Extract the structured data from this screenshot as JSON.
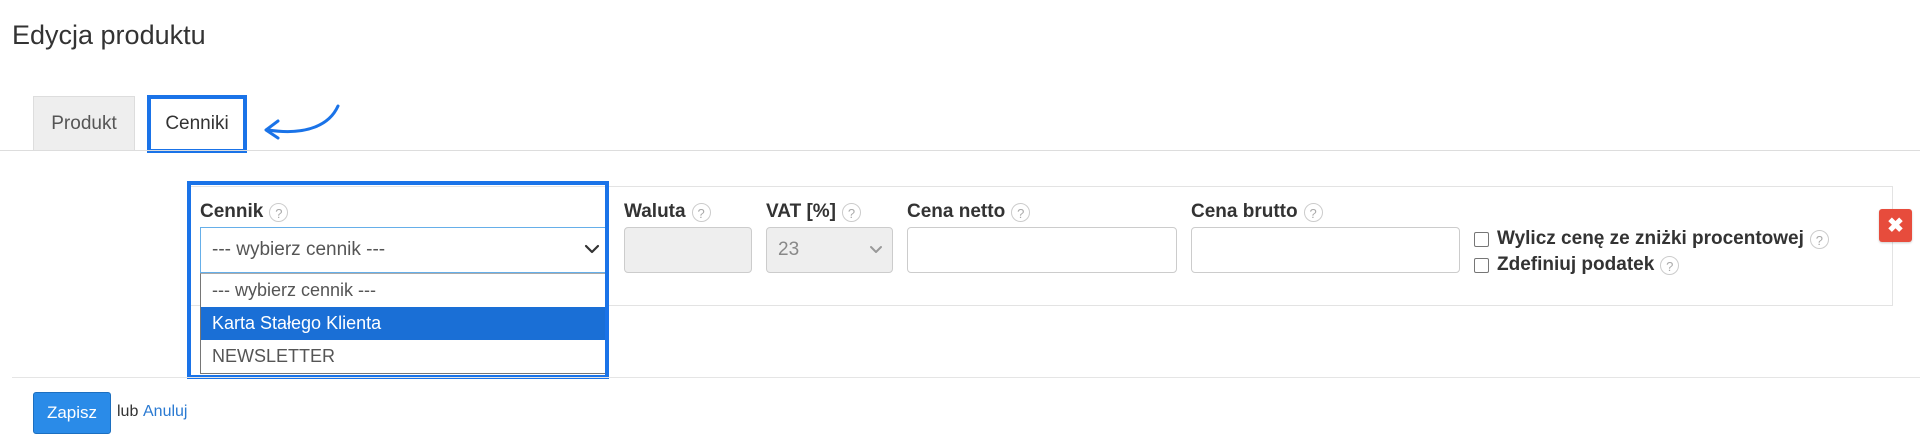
{
  "page": {
    "title": "Edycja produktu"
  },
  "tabs": [
    {
      "label": "Produkt"
    },
    {
      "label": "Cenniki"
    }
  ],
  "form": {
    "cennik": {
      "label": "Cennik",
      "help": "?",
      "selected": "--- wybierz cennik ---",
      "options": [
        "--- wybierz cennik ---",
        "Karta Stałego Klienta",
        "NEWSLETTER"
      ]
    },
    "waluta": {
      "label": "Waluta",
      "help": "?",
      "value": ""
    },
    "vat": {
      "label": "VAT [%]",
      "help": "?",
      "value": "23"
    },
    "cena_netto": {
      "label": "Cena netto",
      "help": "?",
      "value": ""
    },
    "cena_brutto": {
      "label": "Cena brutto",
      "help": "?",
      "value": ""
    },
    "checkbox_znizka": {
      "label": "Wylicz cenę ze zniżki procentowej",
      "help": "?",
      "checked": false
    },
    "checkbox_podatek": {
      "label": "Zdefiniuj podatek",
      "help": "?",
      "checked": false
    },
    "delete_icon": "✖"
  },
  "actions": {
    "save_label": "Zapisz",
    "or_text": "lub",
    "cancel_label": "Anuluj"
  },
  "colors": {
    "highlight": "#1a73e8",
    "selected_option": "#1a6fd6",
    "delete_button": "#e74c3c",
    "save_button": "#2a8be8",
    "link": "#2a7ad2"
  },
  "icons": [
    "curved-arrow-icon",
    "chevron-down-icon",
    "help-icon",
    "close-icon"
  ]
}
